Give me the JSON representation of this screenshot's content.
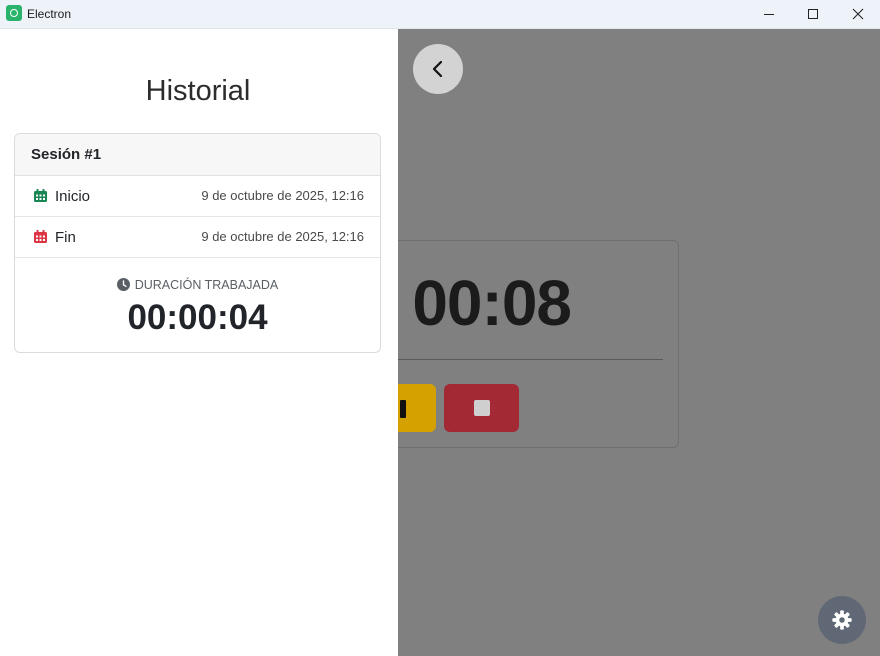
{
  "window": {
    "title": "Electron"
  },
  "drawer": {
    "title": "Historial",
    "session": {
      "header": "Sesión #1",
      "start_label": "Inicio",
      "start_value": "9 de octubre de 2025, 12:16",
      "end_label": "Fin",
      "end_value": "9 de octubre de 2025, 12:16",
      "duration_label": "DURACIÓN TRABAJADA",
      "duration_value": "00:00:04"
    }
  },
  "timer": {
    "display": "00:08"
  },
  "icons": {
    "calendar_start_color": "#198754",
    "calendar_end_color": "#dc3545",
    "names": [
      "app-icon",
      "minimize-icon",
      "maximize-icon",
      "close-icon",
      "chevron-left-icon",
      "calendar-icon",
      "clock-icon",
      "pause-icon",
      "stop-icon",
      "gear-icon"
    ]
  }
}
